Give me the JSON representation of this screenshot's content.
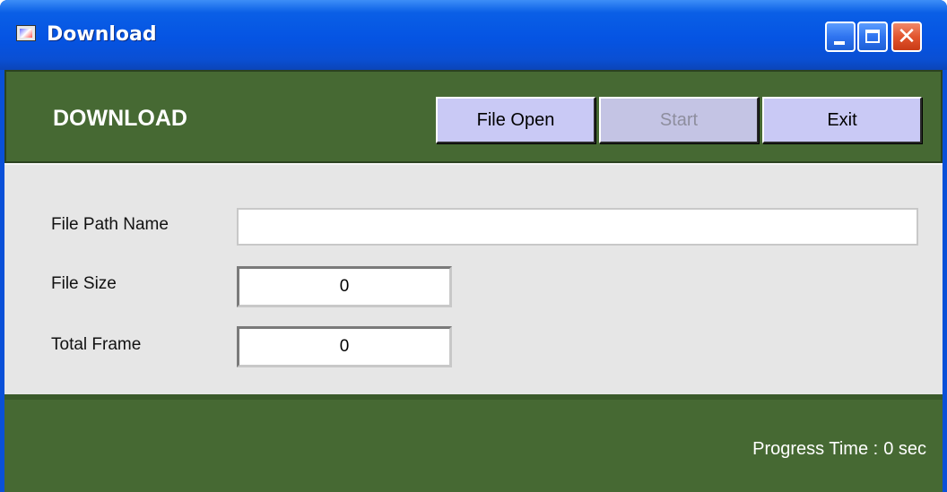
{
  "window": {
    "title": "Download",
    "title_icon": "app-icon",
    "controls": {
      "minimize": "minimize-icon",
      "maximize": "maximize-icon",
      "close": "close-icon",
      "close_glyph": "✕"
    }
  },
  "header": {
    "title": "DOWNLOAD",
    "buttons": {
      "file_open": "File Open",
      "start": "Start",
      "exit": "Exit"
    }
  },
  "form": {
    "file_path_label": "File Path Name",
    "file_path_value": "",
    "file_size_label": "File Size",
    "file_size_value": "0",
    "total_frame_label": "Total Frame",
    "total_frame_value": "0"
  },
  "footer": {
    "progress_label": "Progress Time :",
    "progress_value": "0 sec"
  },
  "colors": {
    "title_bar": "#0554e3",
    "band_green": "#466933",
    "button_face": "#c9c9f5",
    "panel_gray": "#e6e6e6"
  }
}
